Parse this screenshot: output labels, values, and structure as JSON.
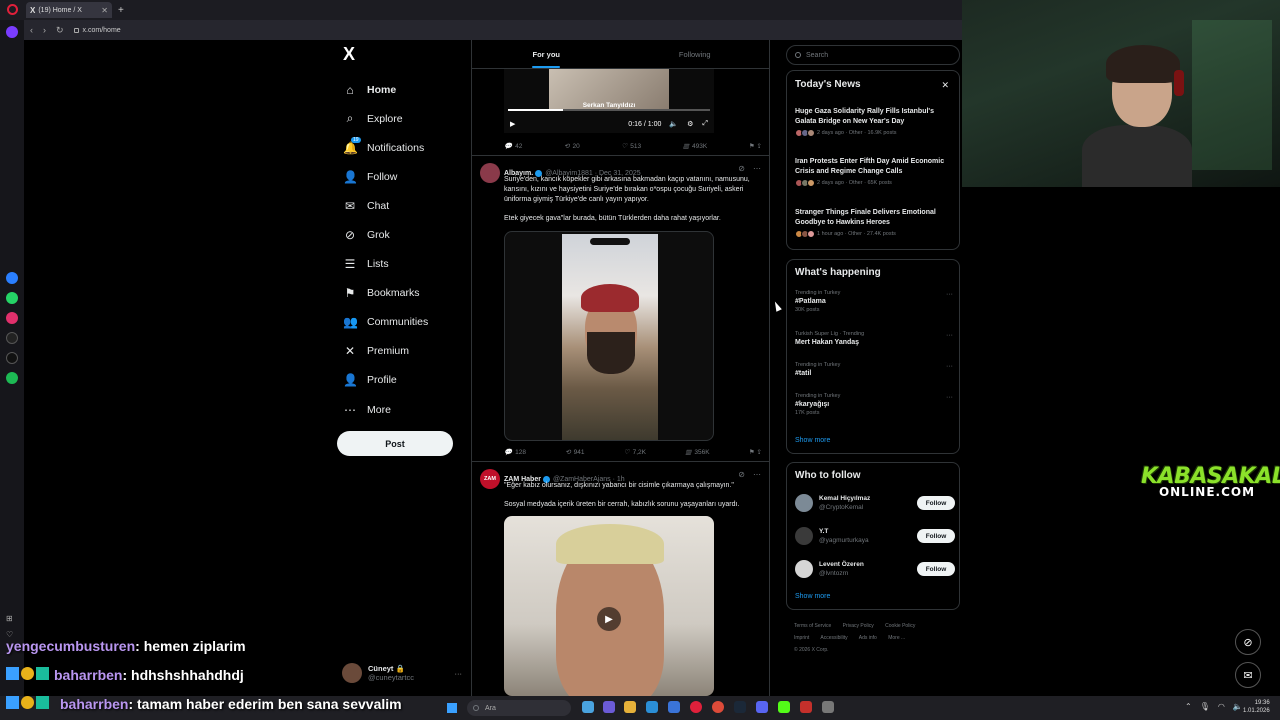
{
  "browser": {
    "tab_title": "(19) Home / X",
    "url": "x.com/home"
  },
  "nav": {
    "logo": "X",
    "items": [
      {
        "label": "Home",
        "icon": "home-icon",
        "glyph": "⌂"
      },
      {
        "label": "Explore",
        "icon": "search-icon",
        "glyph": "⌕"
      },
      {
        "label": "Notifications",
        "icon": "bell-icon",
        "glyph": "🔔",
        "badge": "19"
      },
      {
        "label": "Follow",
        "icon": "person-add-icon",
        "glyph": "👤"
      },
      {
        "label": "Chat",
        "icon": "mail-icon",
        "glyph": "✉"
      },
      {
        "label": "Grok",
        "icon": "grok-icon",
        "glyph": "⊘"
      },
      {
        "label": "Lists",
        "icon": "list-icon",
        "glyph": "☰"
      },
      {
        "label": "Bookmarks",
        "icon": "bookmark-icon",
        "glyph": "⚑"
      },
      {
        "label": "Communities",
        "icon": "people-icon",
        "glyph": "👥"
      },
      {
        "label": "Premium",
        "icon": "x-premium-icon",
        "glyph": "✕"
      },
      {
        "label": "Profile",
        "icon": "profile-icon",
        "glyph": "👤"
      },
      {
        "label": "More",
        "icon": "more-circle-icon",
        "glyph": "⋯"
      }
    ],
    "post_label": "Post",
    "account": {
      "name": "Cüneyt 🔒",
      "handle": "@cuneytartcc",
      "dots": "···"
    }
  },
  "timeline": {
    "tabs": [
      "For you",
      "Following"
    ],
    "tweet1": {
      "video_caption": "Serkan Tanyıldızı",
      "video_time": "0:16 / 1:00",
      "video_progress": 0.27,
      "stats": {
        "replies": "42",
        "reposts": "20",
        "likes": "513",
        "views": "493K"
      }
    },
    "tweet2": {
      "name": "Albayım.",
      "meta": "@Albayim1881 · Dec 31, 2025",
      "text1": "Suriye'den, kancık köpekler gibi arkasına bakmadan kaçıp vatanını, namusunu, karısını, kızını ve haysiyetini Suriye'de bırakan o*ospu çocuğu Suriyeli, askeri üniforma giymiş Türkiye'de canlı yayın yapıyor.",
      "text2": "Etek giyecek gava\"lar burada, bütün Türklerden daha rahat yaşıyorlar.",
      "stats": {
        "replies": "128",
        "reposts": "941",
        "likes": "7,2K",
        "views": "356K"
      }
    },
    "tweet3": {
      "name": "ZAM Haber",
      "meta": "@ZamHaberAjans · 1h",
      "avatar_text": "ZAM",
      "text1": "\"Eğer kabız olursanız, dışkınızı yabancı bir cisimle çıkarmaya çalışmayın.\"",
      "text2": "Sosyal medyada içerik üreten bir cerrah, kabızlık sorunu yaşayanları uyardı."
    }
  },
  "sidebar": {
    "search_placeholder": "Search",
    "news": {
      "title": "Today's News",
      "items": [
        {
          "title": "Huge Gaza Solidarity Rally Fills Istanbul's Galata Bridge on New Year's Day",
          "meta": "2 days ago · Other · 16.9K posts"
        },
        {
          "title": "Iran Protests Enter Fifth Day Amid Economic Crisis and Regime Change Calls",
          "meta": "2 days ago · Other · 65K posts"
        },
        {
          "title": "Stranger Things Finale Delivers Emotional Goodbye to Hawkins Heroes",
          "meta": "1 hour ago · Other · 27.4K posts"
        }
      ]
    },
    "happening": {
      "title": "What's happening",
      "items": [
        {
          "context": "Trending in Turkey",
          "name": "#Patlama",
          "count": "30K posts"
        },
        {
          "context": "Turkish Super Lig · Trending",
          "name": "Mert Hakan Yandaş",
          "count": ""
        },
        {
          "context": "Trending in Turkey",
          "name": "#tatil",
          "count": ""
        },
        {
          "context": "Trending in Turkey",
          "name": "#karyağışı",
          "count": "17K posts"
        }
      ],
      "show_more": "Show more"
    },
    "who_to_follow": {
      "title": "Who to follow",
      "items": [
        {
          "name": "Kemal Hiçyılmaz",
          "handle": "@CryptoKemal",
          "button": "Follow"
        },
        {
          "name": "Y.T",
          "handle": "@yagmurturkaya",
          "button": "Follow"
        },
        {
          "name": "Levent Özeren",
          "handle": "@lvntozrn",
          "button": "Follow"
        }
      ],
      "show_more": "Show more"
    },
    "footer": [
      "Terms of Service",
      "Privacy Policy",
      "Cookie Policy",
      "Imprint",
      "Accessibility",
      "Ads info",
      "More ...",
      "© 2026 X Corp."
    ]
  },
  "stream": {
    "logo_big": "KABASAKAL",
    "logo_small": "ONLINE.COM",
    "chat": [
      {
        "user": "yengecumbusturen",
        "message": ": hemen ziplarim"
      },
      {
        "user": "baharrben",
        "message": ": hdhshshhahdhdj"
      },
      {
        "user": "baharrben",
        "message": ": tamam haber ederim ben sana sevvalim"
      }
    ]
  },
  "taskbar": {
    "search": "Ara",
    "time": "19:36",
    "date": "1.01.2026"
  },
  "colors": {
    "accent": "#1d9bf0",
    "background": "#000000",
    "border": "#2f3336",
    "muted_text": "#71767b",
    "logo_green": "#8be12a"
  }
}
